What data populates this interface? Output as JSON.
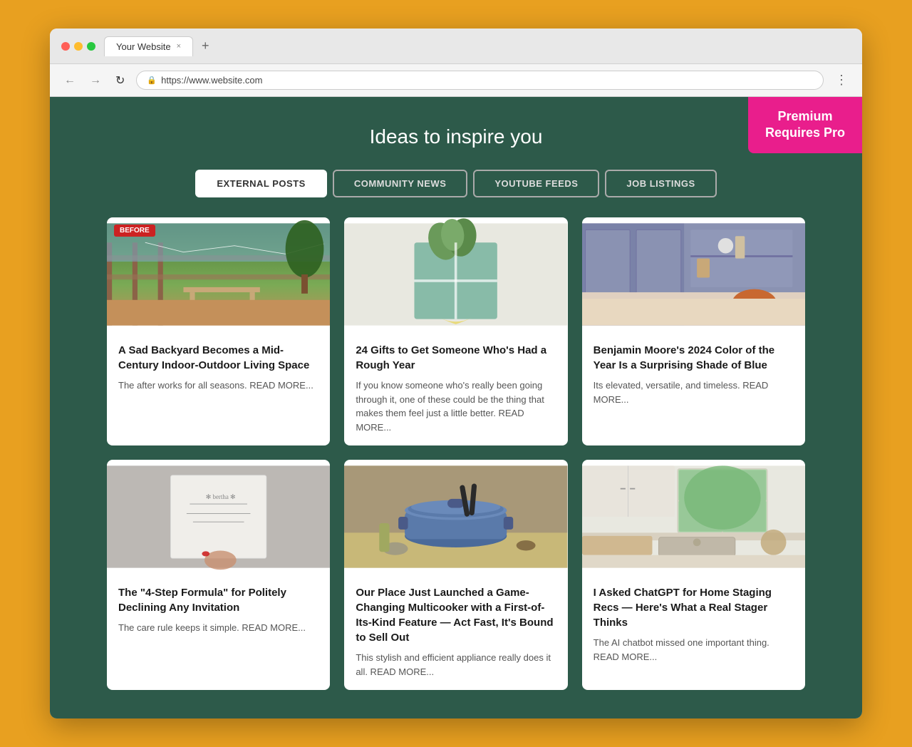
{
  "browser": {
    "tab_title": "Your Website",
    "url": "https://www.website.com",
    "tab_close": "×",
    "tab_new": "+"
  },
  "nav": {
    "back": "←",
    "forward": "→",
    "refresh": "↻",
    "menu": "⋮"
  },
  "premium": {
    "line1": "Premium",
    "line2": "Requires Pro"
  },
  "page": {
    "title": "Ideas to inspire you"
  },
  "tabs": [
    {
      "label": "EXTERNAL POSTS",
      "active": true
    },
    {
      "label": "COMMUNITY NEWS",
      "active": false
    },
    {
      "label": "YOUTUBE FEEDS",
      "active": false
    },
    {
      "label": "JOB LISTINGS",
      "active": false
    }
  ],
  "articles": [
    {
      "id": 1,
      "before_badge": "BEFORE",
      "title": "A Sad Backyard Becomes a Mid-Century Indoor-Outdoor Living Space",
      "excerpt": "The after works for all seasons. READ MORE...",
      "img_type": "backyard"
    },
    {
      "id": 2,
      "title": "24 Gifts to Get Someone Who's Had a Rough Year",
      "excerpt": "If you know someone who's really been going through it, one of these could be the thing that makes them feel just a little better. READ MORE...",
      "img_type": "gifts"
    },
    {
      "id": 3,
      "title": "Benjamin Moore's 2024 Color of the Year Is a Surprising Shade of Blue",
      "excerpt": "Its elevated, versatile, and timeless. READ MORE...",
      "img_type": "blue_room"
    },
    {
      "id": 4,
      "title": "The \"4-Step Formula\" for Politely Declining Any Invitation",
      "excerpt": "The care rule keeps it simple. READ MORE...",
      "img_type": "paper"
    },
    {
      "id": 5,
      "title": "Our Place Just Launched a Game-Changing Multicooker with a First-of-Its-Kind Feature — Act Fast, It's Bound to Sell Out",
      "excerpt": "This stylish and efficient appliance really does it all. READ MORE...",
      "img_type": "pot"
    },
    {
      "id": 6,
      "title": "I Asked ChatGPT for Home Staging Recs — Here's What a Real Stager Thinks",
      "excerpt": "The AI chatbot missed one important thing. READ MORE...",
      "img_type": "kitchen"
    }
  ]
}
